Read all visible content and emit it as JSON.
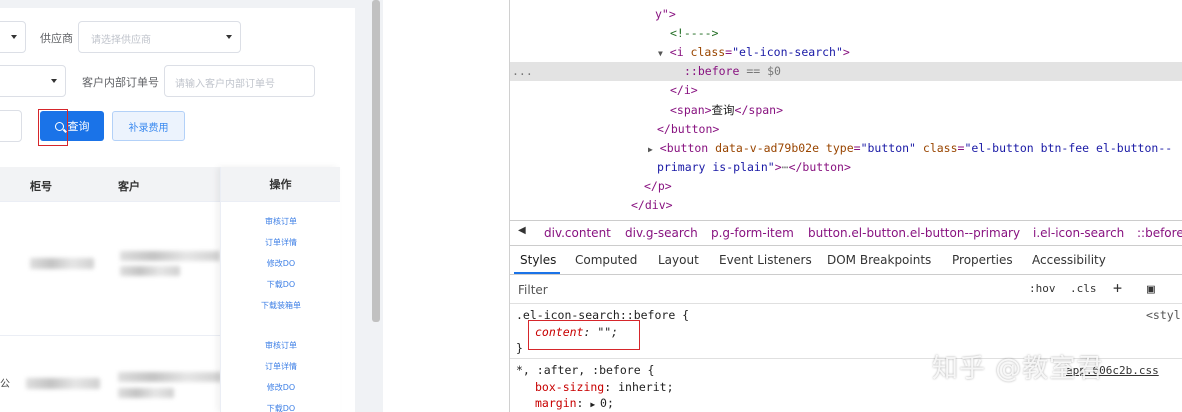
{
  "app": {
    "filters": {
      "supplier_label": "供应商",
      "supplier_placeholder": "请选择供应商",
      "customer_order_label": "客户内部订单号",
      "customer_order_placeholder": "请输入客户内部订单号"
    },
    "buttons": {
      "search_label": "查询",
      "supplement_fee_label": "补录费用"
    },
    "table": {
      "headers": [
        "柜号",
        "客户",
        "操作"
      ],
      "rows": [
        {
          "actions": [
            "审核订单",
            "订单详情",
            "修改DO",
            "下载DO",
            "下载装箱单"
          ]
        },
        {
          "actions": [
            "审核订单",
            "订单详情",
            "修改DO",
            "下载DO"
          ]
        }
      ],
      "partial_text": "公"
    }
  },
  "devtools": {
    "elements": {
      "lines": [
        "y\">",
        "<!---->",
        "<i class=\"el-icon-search\">",
        "::before == $0",
        "</i>",
        "<span>查询</span>",
        "</button>",
        "<button data-v-ad79b02e type=\"button\" class=\"el-button btn-fee el-button--",
        "primary is-plain\">",
        "</button>",
        "</p>",
        "</div>"
      ]
    },
    "breadcrumbs": [
      "div.content",
      "div.g-search",
      "p.g-form-item",
      "button.el-button.el-button--primary",
      "i.el-icon-search",
      "::before"
    ],
    "tabs": [
      "Styles",
      "Computed",
      "Layout",
      "Event Listeners",
      "DOM Breakpoints",
      "Properties",
      "Accessibility"
    ],
    "active_tab": "Styles",
    "filter_placeholder": "Filter",
    "filter_tools": [
      ":hov",
      ".cls",
      "+"
    ],
    "rules": [
      {
        "selector": ".el-icon-search::before {",
        "source": "<styl",
        "declarations": [
          {
            "prop": "content",
            "value": "\"\";"
          }
        ],
        "close": "}"
      },
      {
        "selector": "*, :after, :before {",
        "source": "app.606c2b.css",
        "declarations": [
          {
            "prop": "box-sizing",
            "value": "inherit;"
          },
          {
            "prop": "margin",
            "value": "0;"
          }
        ]
      }
    ],
    "dots": "..."
  },
  "watermark": "知乎 @教室君",
  "colors": {
    "primary": "#1a73e8",
    "highlight_box": "#d6262b",
    "tag": "#881280",
    "attr": "#994500",
    "attr_value": "#1a1aa6"
  }
}
